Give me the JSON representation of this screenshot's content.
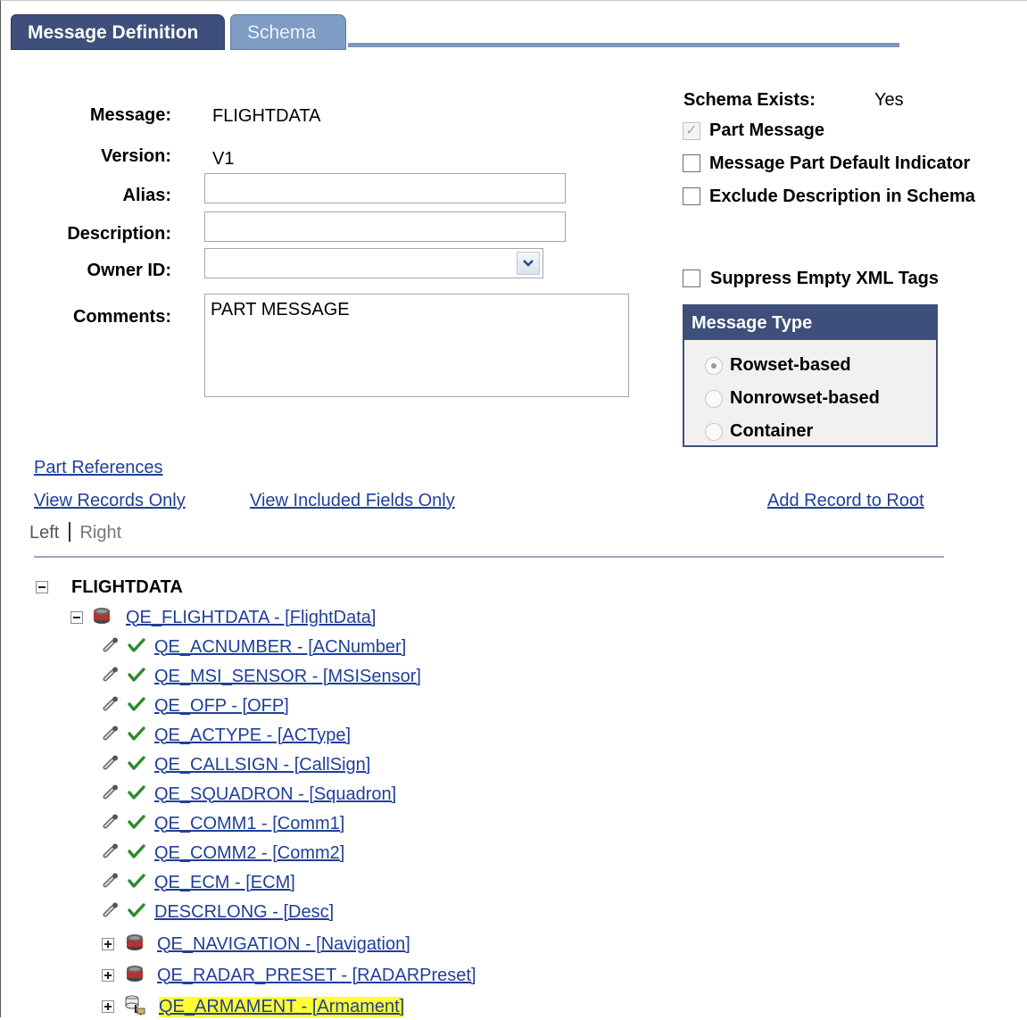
{
  "tabs": [
    {
      "label": "Message Definition"
    },
    {
      "label": "Schema"
    }
  ],
  "form": {
    "message_label": "Message:",
    "message_value": "FLIGHTDATA",
    "version_label": "Version:",
    "version_value": "V1",
    "alias_label": "Alias:",
    "alias_value": "",
    "description_label": "Description:",
    "description_value": "",
    "owner_label": "Owner ID:",
    "owner_value": "",
    "comments_label": "Comments:",
    "comments_value": "PART MESSAGE"
  },
  "options": {
    "schema_exists_label": "Schema Exists:",
    "schema_exists_value": "Yes",
    "part_message": {
      "label": "Part Message",
      "checked": true,
      "disabled": true
    },
    "part_default": {
      "label": "Message Part Default Indicator",
      "checked": false
    },
    "exclude_desc": {
      "label": "Exclude Description in Schema",
      "checked": false
    },
    "suppress_empty": {
      "label": "Suppress Empty XML Tags",
      "checked": false
    }
  },
  "message_type": {
    "title": "Message Type",
    "options": [
      "Rowset-based",
      "Nonrowset-based",
      "Container"
    ],
    "selected": "Rowset-based"
  },
  "links": {
    "part_references": "Part References",
    "view_records_only": "View Records Only",
    "view_included_fields_only": "View Included Fields Only",
    "add_record_to_root": "Add Record to Root",
    "left": "Left",
    "right": "Right"
  },
  "tree": {
    "root": "FLIGHTDATA",
    "record": "QE_FLIGHTDATA - [FlightData]",
    "fields": [
      "QE_ACNUMBER - [ACNumber]",
      "QE_MSI_SENSOR - [MSISensor]",
      "QE_OFP - [OFP]",
      "QE_ACTYPE - [ACType]",
      "QE_CALLSIGN - [CallSign]",
      "QE_SQUADRON - [Squadron]",
      "QE_COMM1 - [Comm1]",
      "QE_COMM2 - [Comm2]",
      "QE_ECM - [ECM]",
      "DESCRLONG - [Desc]"
    ],
    "children": [
      "QE_NAVIGATION - [Navigation]",
      "QE_RADAR_PRESET - [RADARPreset]",
      "QE_ARMAMENT - [Armament]"
    ]
  },
  "colors": {
    "tab_active": "#3d4f7a",
    "tab_inactive": "#7f9cc5",
    "link": "#1f3f9a",
    "check": "#2e8b2e",
    "highlight": "#ffff33"
  }
}
